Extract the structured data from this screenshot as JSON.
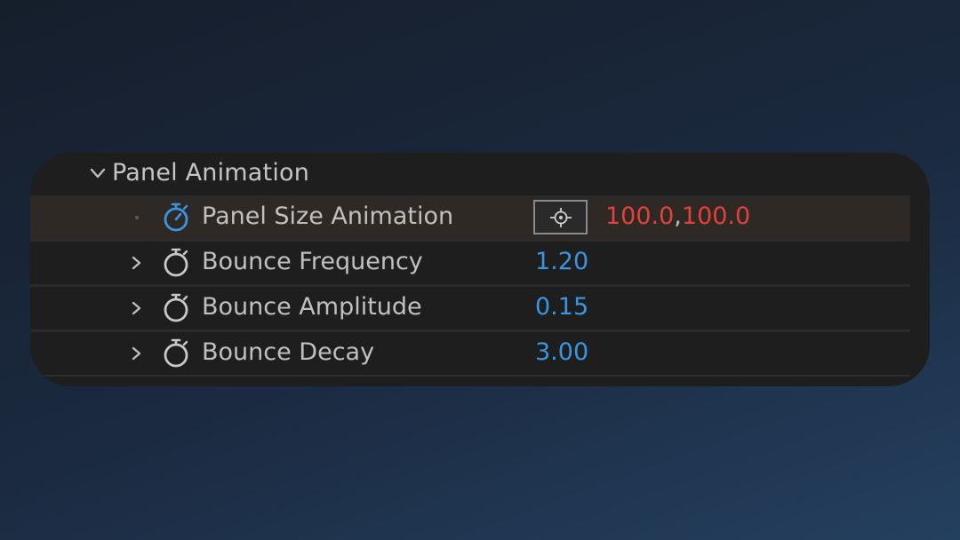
{
  "group": {
    "title": "Panel Animation",
    "expanded": true,
    "chevron_icon": "chevron-down-icon"
  },
  "properties": [
    {
      "name": "Panel Size Animation",
      "stopwatch_icon": "stopwatch-icon",
      "stopwatch_active": true,
      "has_target_button": true,
      "target_icon": "crosshair-icon",
      "value_x": "100.0",
      "value_separator": ",",
      "value_y": "100.0",
      "value_color": "#e3413b"
    },
    {
      "name": "Bounce Frequency",
      "stopwatch_icon": "stopwatch-icon",
      "value": "1.20",
      "value_color": "#3a95e0"
    },
    {
      "name": "Bounce Amplitude",
      "stopwatch_icon": "stopwatch-icon",
      "value": "0.15",
      "value_color": "#3a95e0"
    },
    {
      "name": "Bounce Decay",
      "stopwatch_icon": "stopwatch-icon",
      "value": "3.00",
      "value_color": "#3a95e0"
    }
  ],
  "colors": {
    "active_stopwatch": "#3a95e0",
    "inactive_stopwatch": "#c8c8c8",
    "panel_bg": "#1e1e1e",
    "active_row_bg": "#2e2925"
  }
}
